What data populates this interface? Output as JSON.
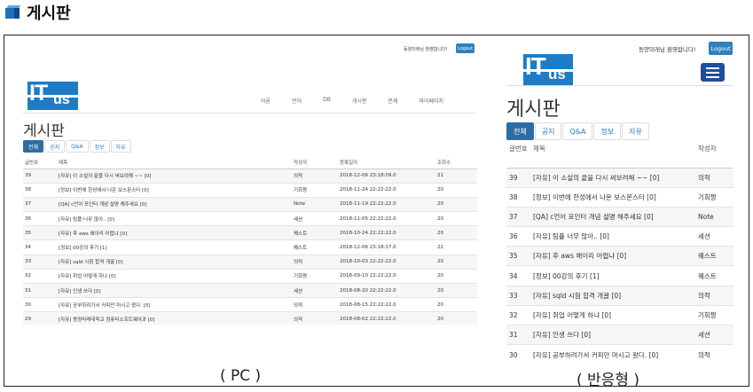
{
  "doc": {
    "icon": "cube-icon",
    "title": "게시판",
    "caption_pc": "( PC )",
    "caption_mobile": "( 반응형 )"
  },
  "pc": {
    "user_text": "동양미래님 환영합니다!",
    "logout_label": "Logout",
    "logo_it": "IT",
    "logo_us": "us",
    "nav": [
      "어론",
      "언어",
      "DB",
      "게시판",
      "문제",
      "마이페이지"
    ],
    "page_title": "게시판",
    "tabs": [
      "전체",
      "공지",
      "Q&A",
      "정보",
      "자유"
    ],
    "columns": [
      "글번호",
      "제목",
      "작성자",
      "등록일자",
      "조회수"
    ],
    "rows": [
      [
        "39",
        "[자유] 이 소설의 끝을 다시 써보려해 ~~ [0]",
        "의적",
        "2018-12-06 23:18:09.0",
        "21"
      ],
      [
        "38",
        "[정보] 이번에 한성에서 나온 보스몬스터 [0]",
        "기회짱",
        "2018-11-24 22:22:22.0",
        "20"
      ],
      [
        "37",
        "[QA] c언어 포인터 개념 설명 해주세요 [0]",
        "Note",
        "2018-11-19 22:22:22.0",
        "20"
      ],
      [
        "36",
        "[자유] 팀플 너무 많아.. [0]",
        "세션",
        "2018-11-05 22:22:22.0",
        "20"
      ],
      [
        "35",
        "[자유] 후 aws 왜이리 어렵냐 [0]",
        "퀘스트",
        "2018-10-24 22:22:22.0",
        "20"
      ],
      [
        "34",
        "[정보] 00강의 후기 [1]",
        "퀘스트",
        "2018-12-06 23:18:17.0",
        "22"
      ],
      [
        "33",
        "[자유] sqld 시험 합격 개꿀 [0]",
        "의적",
        "2018-10-03 22:22:22.0",
        "20"
      ],
      [
        "32",
        "[자유] 취업 어떻게 하냐 [0]",
        "기회짱",
        "2018-09-10 22:22:22.0",
        "20"
      ],
      [
        "31",
        "[자유] 인생 쓰다 [0]",
        "세션",
        "2018-08-20 22:22:22.0",
        "20"
      ],
      [
        "30",
        "[자유] 공부하려가서 커피만 마시고 왔다. [0]",
        "의적",
        "2018-08-15 22:22:22.0",
        "20"
      ],
      [
        "29",
        "[자유] 동양미래대학교 컴퓨터소프트웨어과 [0]",
        "의적",
        "2018-08-02 22:22:22.0",
        "20"
      ]
    ]
  },
  "mobile": {
    "user_text": "동양미래님 환영합니다!",
    "logout_label": "Logout",
    "logo_it": "IT",
    "logo_us": "us",
    "menu_icon": "hamburger-menu-icon",
    "page_title": "게시판",
    "tabs": [
      "전체",
      "공지",
      "Q&A",
      "정보",
      "자유"
    ],
    "columns": [
      "글번호",
      "제목",
      "작성자"
    ],
    "rows": [
      [
        "39",
        "[자유] 이 소설의 끝을 다시 써보려해 ~~ [0]",
        "의적"
      ],
      [
        "38",
        "[정보] 이번에 한성에서 나온 보스몬스터 [0]",
        "기회짱"
      ],
      [
        "37",
        "[QA] c언어 포인터 개념 설명 해주세요 [0]",
        "Note"
      ],
      [
        "36",
        "[자유] 팀플 너무 많아.. [0]",
        "세션"
      ],
      [
        "35",
        "[자유] 후 aws 왜이리 어렵냐 [0]",
        "퀘스트"
      ],
      [
        "34",
        "[정보] 00강의 후기 [1]",
        "퀘스트"
      ],
      [
        "33",
        "[자유] sqld 시험 합격 개꿀 [0]",
        "의적"
      ],
      [
        "32",
        "[자유] 취업 어떻게 하냐 [0]",
        "기회짱"
      ],
      [
        "31",
        "[자유] 인생 쓰다 [0]",
        "세션"
      ],
      [
        "30",
        "[자유] 공부하려가서 커피만 마시고 왔다. [0]",
        "의적"
      ]
    ]
  }
}
